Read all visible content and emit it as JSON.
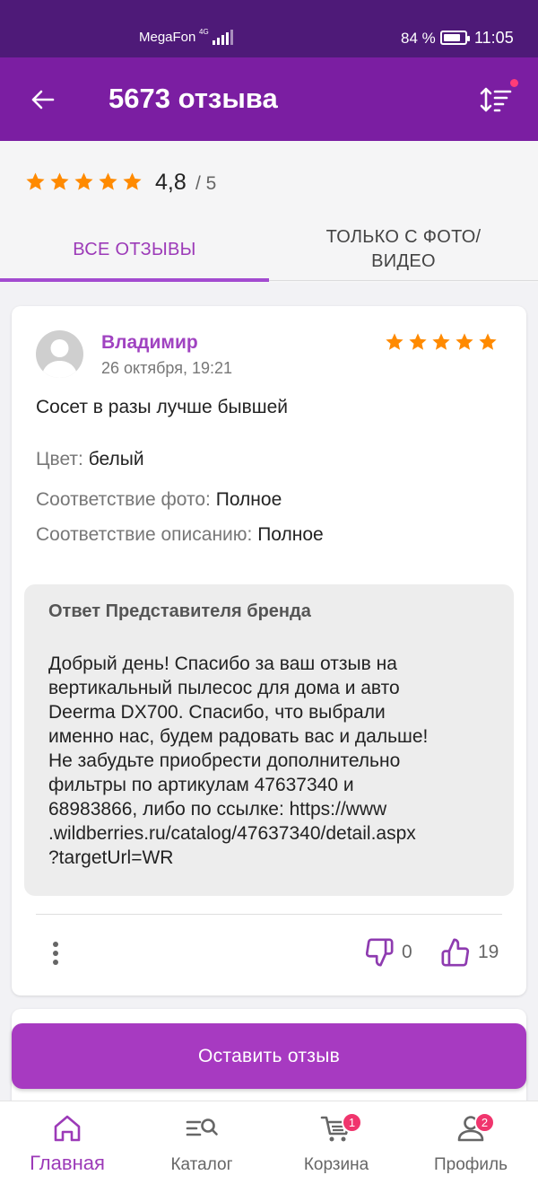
{
  "status_bar": {
    "carrier": "MegaFon",
    "network": "4G",
    "battery_percent": "84 %",
    "battery_level": 0.84,
    "time": "11:05"
  },
  "header": {
    "title": "5673 отзыва",
    "back_icon": "arrow-left-icon",
    "sort_icon": "sort-icon",
    "sort_indicator_color": "#ff3c78"
  },
  "summary": {
    "stars": 5,
    "rating": "4,8",
    "rating_max": "/ 5",
    "star_color": "#ff8a00"
  },
  "tabs": [
    {
      "label": "ВСЕ ОТЗЫВЫ",
      "active": true
    },
    {
      "label": "ТОЛЬКО С ФОТО/ ВИДЕО",
      "active": false
    }
  ],
  "review": {
    "author": "Владимир",
    "date": "26 октября, 19:21",
    "stars": 5,
    "text": "Сосет в разы лучше бывшей",
    "attributes": [
      {
        "key": "Цвет:",
        "value": "белый"
      },
      {
        "key": "Соответствие фото:",
        "value": "Полное"
      },
      {
        "key": "Соответствие описанию:",
        "value": "Полное"
      }
    ],
    "brand_reply": {
      "title": "Ответ Представителя бренда",
      "text": "Добрый день! Спасибо за ваш отзыв на\nвертикальный пылесос для дома и авто\nDeerma DX700. Спасибо, что выбрали\nименно нас, будем радовать вас и дальше!\nНе забудьте приобрести дополнительно\nфильтры по артикулам 47637340 и\n68983866, либо по ссылке: https://www\n.wildberries.ru/catalog/47637340/detail.aspx\n?targetUrl=WR"
    },
    "dislikes": "0",
    "likes": "19"
  },
  "cta": {
    "label": "Оставить отзыв"
  },
  "bottom_nav": [
    {
      "label": "Главная",
      "icon": "home-icon",
      "active": true,
      "badge": ""
    },
    {
      "label": "Каталог",
      "icon": "catalog-search-icon",
      "active": false,
      "badge": ""
    },
    {
      "label": "Корзина",
      "icon": "cart-icon",
      "active": false,
      "badge": "1"
    },
    {
      "label": "Профиль",
      "icon": "profile-icon",
      "active": false,
      "badge": "2"
    }
  ],
  "colors": {
    "status_bar": "#4e1a78",
    "app_bar": "#7b1ea2",
    "accent": "#a73ac1",
    "badge": "#f0356d"
  }
}
